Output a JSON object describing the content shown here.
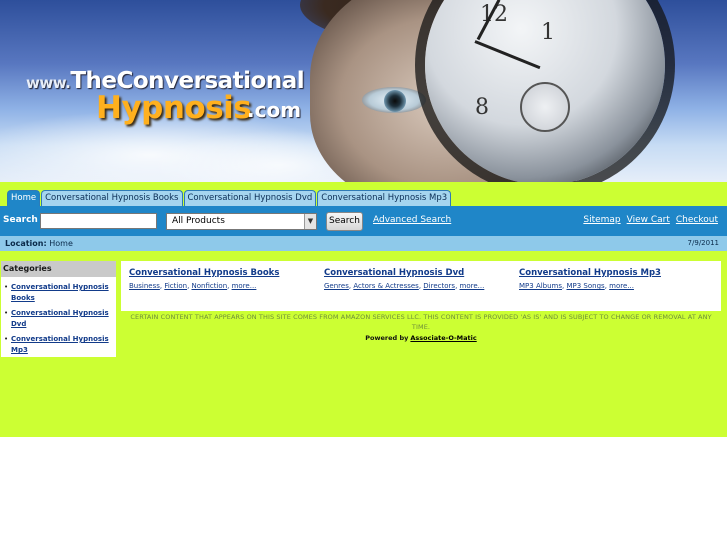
{
  "banner": {
    "logo_www": "www.",
    "logo_name": "TheConversational",
    "logo_word": "Hypnosis",
    "logo_tld": ".com"
  },
  "tabs": [
    {
      "label": "Home",
      "active": true
    },
    {
      "label": "Conversational Hypnosis Books",
      "active": false
    },
    {
      "label": "Conversational Hypnosis Dvd",
      "active": false
    },
    {
      "label": "Conversational Hypnosis Mp3",
      "active": false
    }
  ],
  "search": {
    "label": "Search",
    "input_value": "",
    "select_value": "All Products",
    "button_label": "Search",
    "advanced_link": "Advanced Search"
  },
  "header_links": {
    "sitemap": "Sitemap",
    "view_cart": "View Cart",
    "checkout": "Checkout"
  },
  "location": {
    "label": "Location:",
    "value": "Home",
    "date": "7/9/2011"
  },
  "sidebar": {
    "heading": "Categories",
    "items": [
      {
        "label": "Conversational Hypnosis Books"
      },
      {
        "label": "Conversational Hypnosis Dvd"
      },
      {
        "label": "Conversational Hypnosis Mp3"
      }
    ]
  },
  "main": {
    "categories": [
      {
        "title": "Conversational Hypnosis Books",
        "links": [
          "Business",
          "Fiction",
          "Nonfiction",
          "more..."
        ]
      },
      {
        "title": "Conversational Hypnosis Dvd",
        "links": [
          "Genres",
          "Actors & Actresses",
          "Directors",
          "more..."
        ]
      },
      {
        "title": "Conversational Hypnosis Mp3",
        "links": [
          "MP3 Albums",
          "MP3 Songs",
          "more..."
        ]
      }
    ]
  },
  "footer": {
    "disclaimer": "CERTAIN CONTENT THAT APPEARS ON THIS SITE COMES FROM AMAZON SERVICES LLC. THIS CONTENT IS PROVIDED 'AS IS' AND IS SUBJECT TO CHANGE OR REMOVAL AT ANY TIME.",
    "powered_label": "Powered by",
    "powered_link": "Associate-O-Matic"
  },
  "colors": {
    "page_background": "#ccff33",
    "nav_blue": "#1f86c8",
    "location_blue": "#8ec9ea",
    "link_blue": "#123b8a",
    "logo_orange": "#ffb01e"
  },
  "icons": {
    "select_arrow": "chevron-down-icon",
    "bullet": "bullet-icon"
  }
}
